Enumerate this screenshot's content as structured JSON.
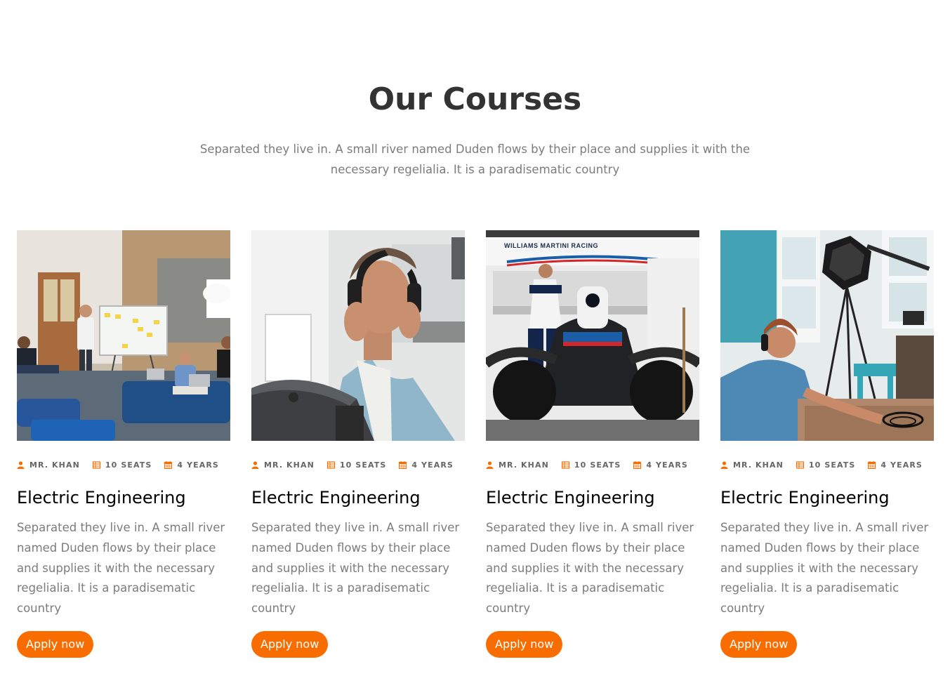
{
  "section": {
    "title": "Our Courses",
    "subtitle": "Separated they live in. A small river named Duden flows by their place and supplies it with the necessary regelialia. It is a paradisematic country"
  },
  "colors": {
    "accent": "#f96d00",
    "heading": "#333333",
    "body_text": "#7c7c7c",
    "meta_text": "#666666"
  },
  "courses": [
    {
      "image": "team-meeting-whiteboard-photo",
      "instructor": "MR. KHAN",
      "seats": "10 SEATS",
      "duration": "4 YEARS",
      "title": "Electric Engineering",
      "description": "Separated they live in. A small river named Duden flows by their place and supplies it with the necessary regelialia. It is a paradisematic country",
      "button": "Apply now"
    },
    {
      "image": "man-headphones-laptop-photo",
      "instructor": "MR. KHAN",
      "seats": "10 SEATS",
      "duration": "4 YEARS",
      "title": "Electric Engineering",
      "description": "Separated they live in. A small river named Duden flows by their place and supplies it with the necessary regelialia. It is a paradisematic country",
      "button": "Apply now"
    },
    {
      "image": "racing-car-garage-photo",
      "image_text": "WILLIAMS MARTINI RACING",
      "instructor": "MR. KHAN",
      "seats": "10 SEATS",
      "duration": "4 YEARS",
      "title": "Electric Engineering",
      "description": "Separated they live in. A small river named Duden flows by their place and supplies it with the necessary regelialia. It is a paradisematic country",
      "button": "Apply now"
    },
    {
      "image": "audio-recording-studio-photo",
      "instructor": "MR. KHAN",
      "seats": "10 SEATS",
      "duration": "4 YEARS",
      "title": "Electric Engineering",
      "description": "Separated they live in. A small river named Duden flows by their place and supplies it with the necessary regelialia. It is a paradisematic country",
      "button": "Apply now"
    }
  ],
  "icons": {
    "instructor": "user-icon",
    "seats": "table-icon",
    "duration": "calendar-icon"
  }
}
